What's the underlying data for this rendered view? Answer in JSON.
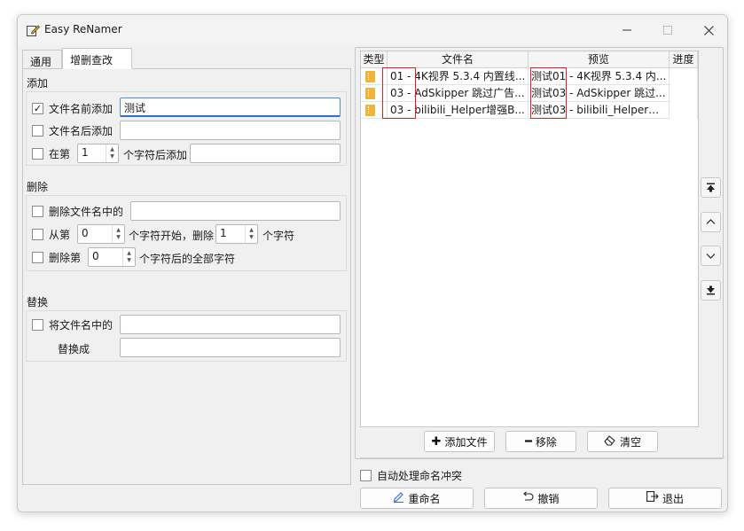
{
  "window": {
    "title": "Easy ReNamer"
  },
  "tabs": [
    {
      "label": "通用"
    },
    {
      "label": "增删查改"
    }
  ],
  "add": {
    "section": "添加",
    "prefix": {
      "label": "文件名前添加",
      "checked": true,
      "value": "测试"
    },
    "suffix": {
      "label": "文件名后添加",
      "checked": false,
      "value": ""
    },
    "at_pos": {
      "label": "在第",
      "pos": "1",
      "after": "个字符后添加",
      "checked": false,
      "value": ""
    }
  },
  "delete": {
    "section": "删除",
    "remove_text": {
      "label": "删除文件名中的",
      "checked": false,
      "value": ""
    },
    "range": {
      "label": "从第",
      "start": "0",
      "mid": "个字符开始，删除",
      "count": "1",
      "end": "个字符",
      "checked": false
    },
    "after": {
      "label": "删除第",
      "pos": "0",
      "end": "个字符后的全部字符",
      "checked": false
    }
  },
  "replace": {
    "section": "替换",
    "find": {
      "label": "将文件名中的",
      "checked": false,
      "value": ""
    },
    "with": {
      "label": "替换成",
      "value": ""
    }
  },
  "table": {
    "columns": [
      "类型",
      "文件名",
      "预览",
      "进度"
    ],
    "rows": [
      {
        "type_icon": "zip-file-icon",
        "filename": "01 - 4K视界 5.3.4 内置线...",
        "preview": "测试01 - 4K视界 5.3.4 内...",
        "progress": ""
      },
      {
        "type_icon": "zip-file-icon",
        "filename": "03 - AdSkipper 跳过广告...",
        "preview": "测试03 - AdSkipper 跳过...",
        "progress": ""
      },
      {
        "type_icon": "zip-file-icon",
        "filename": "03 - bilibili_Helper增强B...",
        "preview": "测试03 - bilibili_Helper增...",
        "progress": ""
      }
    ]
  },
  "list_buttons": {
    "add": "添加文件",
    "remove": "移除",
    "clear": "清空"
  },
  "auto_conflict": {
    "label": "自动处理命名冲突",
    "checked": false
  },
  "actions": {
    "rename": "重命名",
    "undo": "撤销",
    "exit": "退出"
  },
  "colors": {
    "highlight": "#e02020",
    "accent": "#2f6fc4",
    "file_icon": "#f1b43a"
  }
}
